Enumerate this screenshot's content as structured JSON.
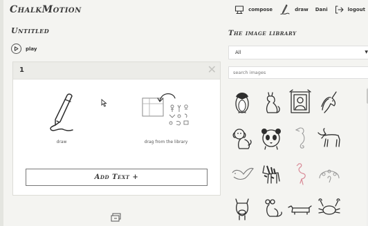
{
  "app": {
    "title": "ChalkMotion"
  },
  "nav": {
    "compose_label": "compose",
    "draw_label": "draw",
    "user_label": "Dani",
    "logout_label": "logout"
  },
  "document": {
    "title": "Untitled",
    "play_label": "play"
  },
  "panel": {
    "number": "1",
    "draw_caption": "draw",
    "library_caption": "drag from the library",
    "add_text_label": "Add Text +"
  },
  "library": {
    "title": "The image library",
    "selected_category": "All",
    "search_placeholder": "search images",
    "images": [
      "penguin",
      "cat",
      "framed-portrait",
      "unicorn",
      "dog",
      "panda",
      "seahorse",
      "moose",
      "bird",
      "zebra",
      "flamingo",
      "peacock",
      "cow",
      "mouse",
      "dachshund",
      "crab"
    ]
  },
  "icons": [
    "compose-icon",
    "draw-icon",
    "logout-icon",
    "play-icon",
    "close-icon",
    "pen-icon",
    "library-icon",
    "cursor-icon",
    "frames-icon",
    "dropdown-caret-icon"
  ],
  "colors": {
    "background": "#f4f4f1",
    "panel_bar": "#ecece8",
    "text": "#333333"
  }
}
